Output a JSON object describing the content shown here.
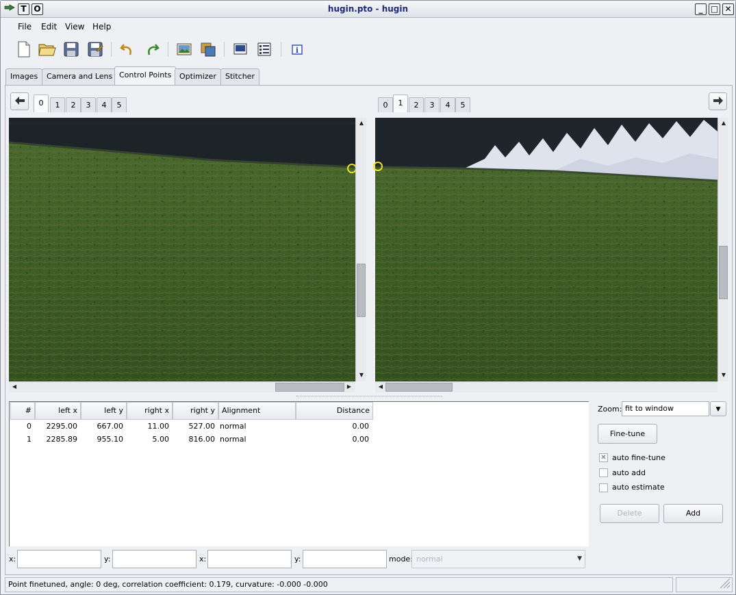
{
  "window": {
    "title": "hugin.pto - hugin",
    "left_buttons": [
      "T",
      "O"
    ],
    "right_buttons": [
      "_",
      "□",
      "✕"
    ]
  },
  "menu": [
    "File",
    "Edit",
    "View",
    "Help"
  ],
  "toolbar_icons": [
    "new-file",
    "open-folder",
    "save",
    "save-as",
    "undo",
    "redo",
    "add-image",
    "add-series",
    "preview",
    "optimize-list",
    "about"
  ],
  "tabs": [
    "Images",
    "Camera and Lens",
    "Control Points",
    "Optimizer",
    "Stitcher"
  ],
  "active_tab": "Control Points",
  "left_image": {
    "tabs": [
      "0",
      "1",
      "2",
      "3",
      "4",
      "5"
    ],
    "selected": "0"
  },
  "right_image": {
    "tabs": [
      "0",
      "1",
      "2",
      "3",
      "4",
      "5"
    ],
    "selected": "1"
  },
  "table": {
    "columns": [
      "#",
      "left x",
      "left y",
      "right x",
      "right y",
      "Alignment",
      "Distance"
    ],
    "rows": [
      [
        "0",
        "2295.00",
        "667.00",
        "11.00",
        "527.00",
        "normal",
        "0.00"
      ],
      [
        "1",
        "2285.89",
        "955.10",
        "5.00",
        "816.00",
        "normal",
        "0.00"
      ]
    ]
  },
  "controls": {
    "zoom_label": "Zoom:",
    "zoom_value": "fit to window",
    "fine_tune": "Fine-tune",
    "auto_fine_tune": "auto fine-tune",
    "auto_fine_tune_checked": true,
    "auto_add": "auto add",
    "auto_add_checked": false,
    "auto_estimate": "auto estimate",
    "auto_estimate_checked": false,
    "delete": "Delete",
    "add": "Add"
  },
  "edit_row": {
    "x1_label": "x:",
    "y1_label": "y:",
    "x2_label": "x:",
    "y2_label": "y:",
    "mode_label": "mode:",
    "mode_value": "normal"
  },
  "status": "Point finetuned, angle: 0 deg, correlation coefficient: 0.179, curvature: -0.000 -0.000"
}
